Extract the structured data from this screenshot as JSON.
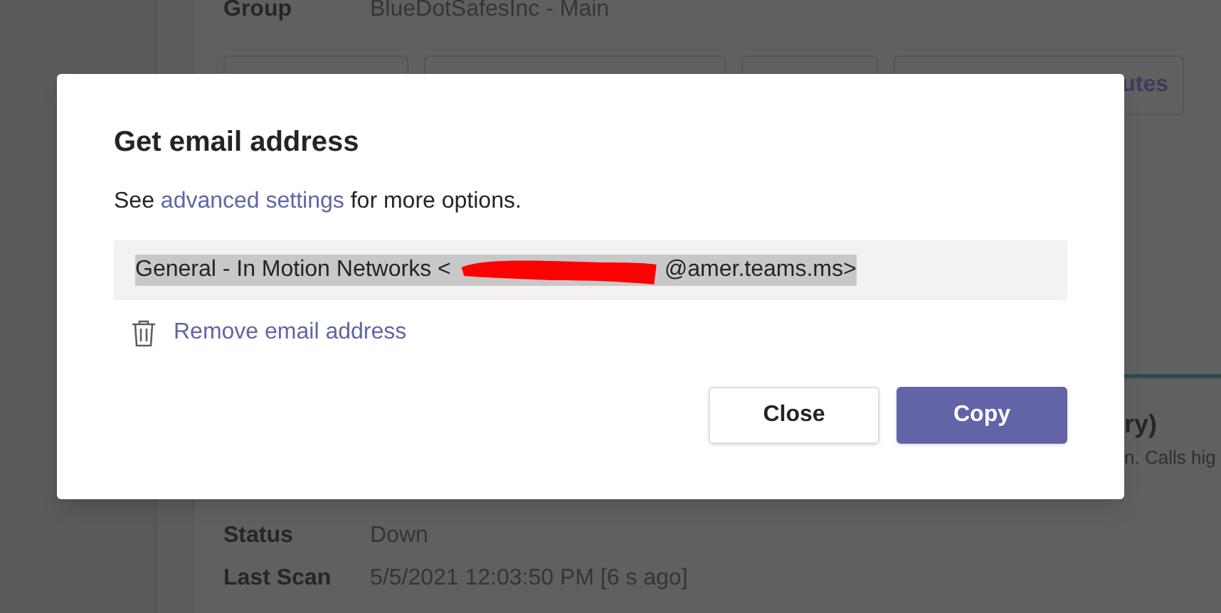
{
  "background": {
    "fields": [
      {
        "label": "Group",
        "value": "BlueDotSafesInc - Main"
      }
    ],
    "buttons": [
      {
        "kind": "blank"
      },
      {
        "kind": "blank"
      },
      {
        "kind": "blank"
      },
      {
        "kind": "text",
        "label": "utes"
      }
    ],
    "side_heading": "ry)",
    "side_text": "n. Calls hig",
    "details": [
      {
        "label": "Status",
        "value": "Down"
      },
      {
        "label": "Last Scan",
        "value": "5/5/2021 12:03:50 PM [6 s ago]"
      }
    ]
  },
  "dialog": {
    "title": "Get email address",
    "intro": {
      "before": "See ",
      "link": "advanced settings",
      "after": " for more options."
    },
    "address": {
      "before": "General - In Motion Networks <",
      "after": "@amer.teams.ms>",
      "redacted": true,
      "selected": true
    },
    "remove_link": "Remove email address",
    "buttons": [
      {
        "label": "Close",
        "kind": "secondary"
      },
      {
        "label": "Copy",
        "kind": "primary"
      }
    ]
  }
}
